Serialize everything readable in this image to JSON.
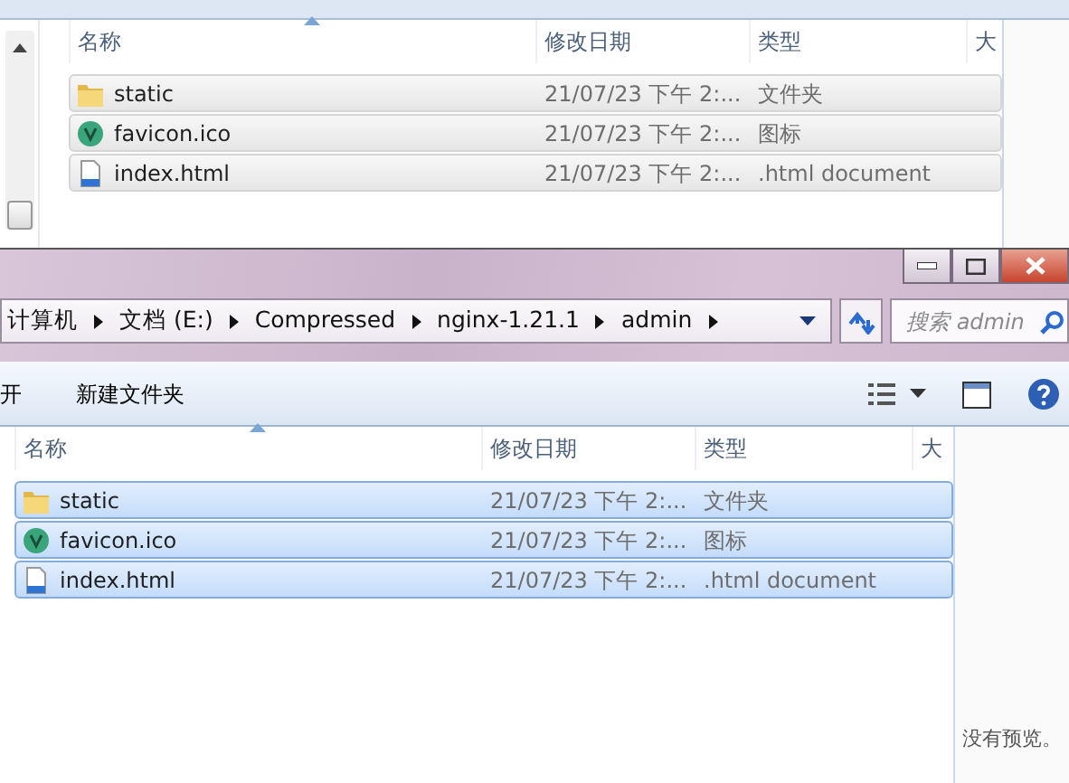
{
  "back_window": {
    "active": false,
    "columns": [
      {
        "label": "名称",
        "sorted": true
      },
      {
        "label": "修改日期",
        "sorted": false
      },
      {
        "label": "类型",
        "sorted": false
      },
      {
        "label": "大",
        "sorted": false
      }
    ],
    "files": [
      {
        "kind": "folder",
        "name": "static",
        "date": "21/07/23 下午 2:...",
        "type": "文件夹",
        "selected": true
      },
      {
        "kind": "vue",
        "name": "favicon.ico",
        "date": "21/07/23 下午 2:...",
        "type": "图标",
        "selected": true
      },
      {
        "kind": "html",
        "name": "index.html",
        "date": "21/07/23 下午 2:...",
        "type": ".html document",
        "selected": true
      }
    ]
  },
  "front_window": {
    "active": true,
    "breadcrumbs": [
      "计算机",
      "文档 (E:)",
      "Compressed",
      "nginx-1.21.1",
      "admin"
    ],
    "search": {
      "placeholder": "搜索 admin"
    },
    "toolbar": [
      "开",
      "新建文件夹"
    ],
    "columns": [
      {
        "label": "名称",
        "sorted": true
      },
      {
        "label": "修改日期",
        "sorted": false
      },
      {
        "label": "类型",
        "sorted": false
      },
      {
        "label": "大",
        "sorted": false
      }
    ],
    "files": [
      {
        "kind": "folder",
        "name": "static",
        "date": "21/07/23 下午 2:...",
        "type": "文件夹",
        "selected": true
      },
      {
        "kind": "vue",
        "name": "favicon.ico",
        "date": "21/07/23 下午 2:...",
        "type": "图标",
        "selected": true
      },
      {
        "kind": "html",
        "name": "index.html",
        "date": "21/07/23 下午 2:...",
        "type": ".html document",
        "selected": true
      }
    ],
    "preview_text": "没有预览。"
  }
}
